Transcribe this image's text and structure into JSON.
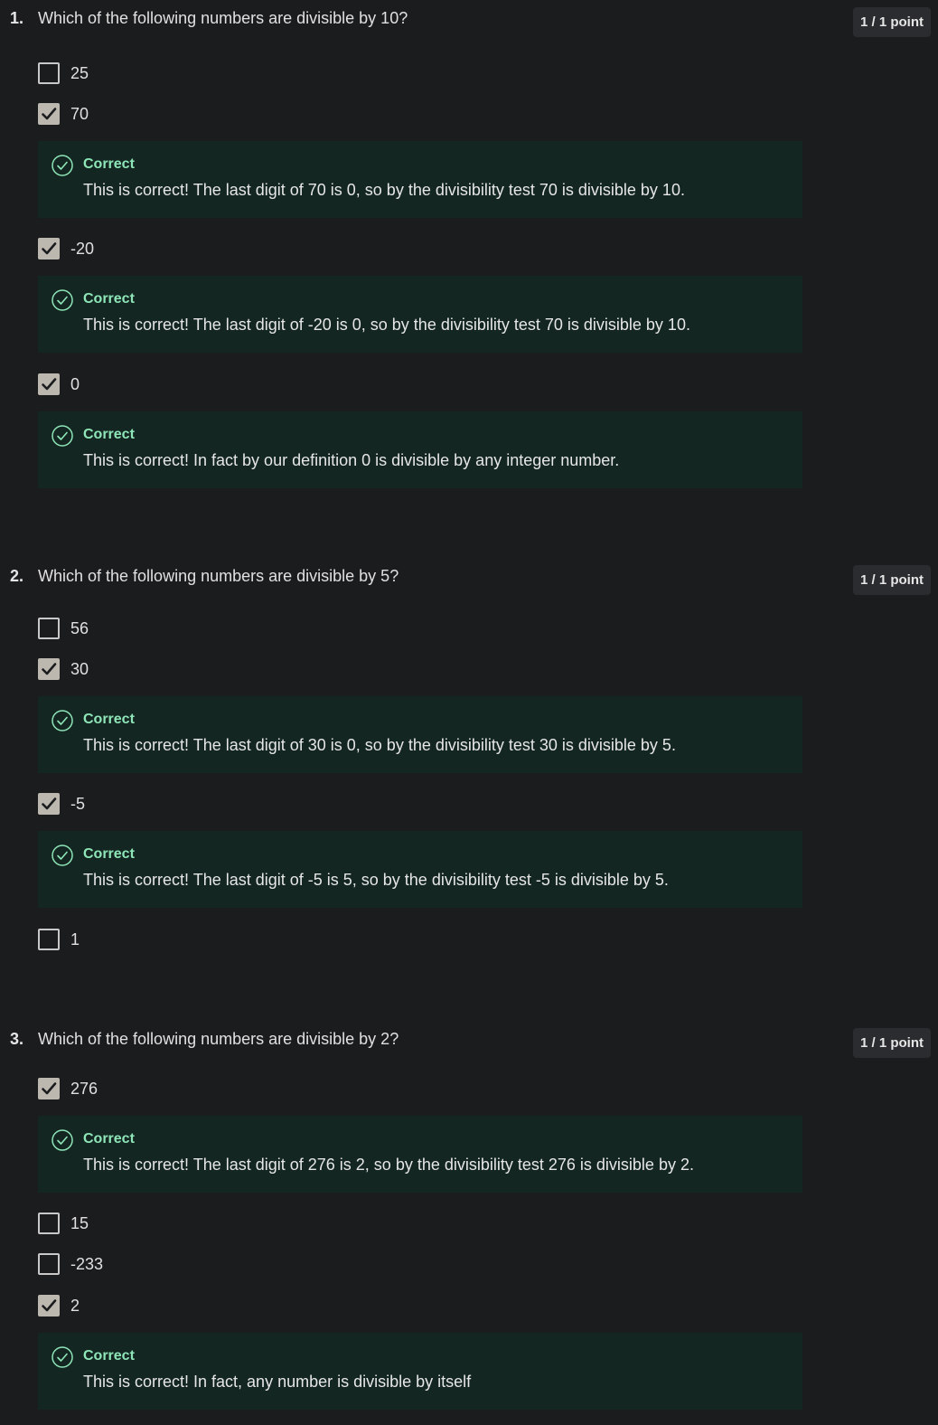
{
  "questions": [
    {
      "number": "1.",
      "text": "Which of the following numbers are divisible by 10?",
      "points": "1 / 1 point",
      "options": [
        {
          "label": "25",
          "checked": false
        },
        {
          "label": "70",
          "checked": true,
          "feedback": {
            "title": "Correct",
            "text": "This is correct! The last digit of 70 is 0, so by the divisibility test 70 is divisible by 10."
          }
        },
        {
          "label": "-20",
          "checked": true,
          "feedback": {
            "title": "Correct",
            "text": "This is correct! The last digit of -20 is 0, so by the divisibility test 70 is divisible by 10."
          }
        },
        {
          "label": "0",
          "checked": true,
          "feedback": {
            "title": "Correct",
            "text": "This is correct! In fact by our definition 0 is divisible by any integer number."
          }
        }
      ]
    },
    {
      "number": "2.",
      "text": "Which of the following numbers are divisible by 5?",
      "points": "1 / 1 point",
      "options": [
        {
          "label": "56",
          "checked": false
        },
        {
          "label": "30",
          "checked": true,
          "feedback": {
            "title": "Correct",
            "text": "This is correct! The last digit of 30 is 0, so by the divisibility test 30 is divisible by 5."
          }
        },
        {
          "label": "-5",
          "checked": true,
          "feedback": {
            "title": "Correct",
            "text": "This is correct! The last digit of -5 is 5, so by the divisibility test -5 is divisible by 5."
          }
        },
        {
          "label": "1",
          "checked": false
        }
      ]
    },
    {
      "number": "3.",
      "text": "Which of the following numbers are divisible by 2?",
      "points": "1 / 1 point",
      "options": [
        {
          "label": "276",
          "checked": true,
          "feedback": {
            "title": "Correct",
            "text": "This is correct! The last digit of 276 is 2, so by the divisibility test 276 is divisible by 2."
          }
        },
        {
          "label": "15",
          "checked": false
        },
        {
          "label": "-233",
          "checked": false
        },
        {
          "label": "2",
          "checked": true,
          "feedback": {
            "title": "Correct",
            "text": "This is correct! In fact, any number is divisible by itself"
          }
        }
      ]
    }
  ],
  "colors": {
    "background": "#1b1c1e",
    "feedback_bg": "#132621",
    "correct_accent": "#8ee6b8",
    "checkbox_checked": "#bdb8af"
  }
}
